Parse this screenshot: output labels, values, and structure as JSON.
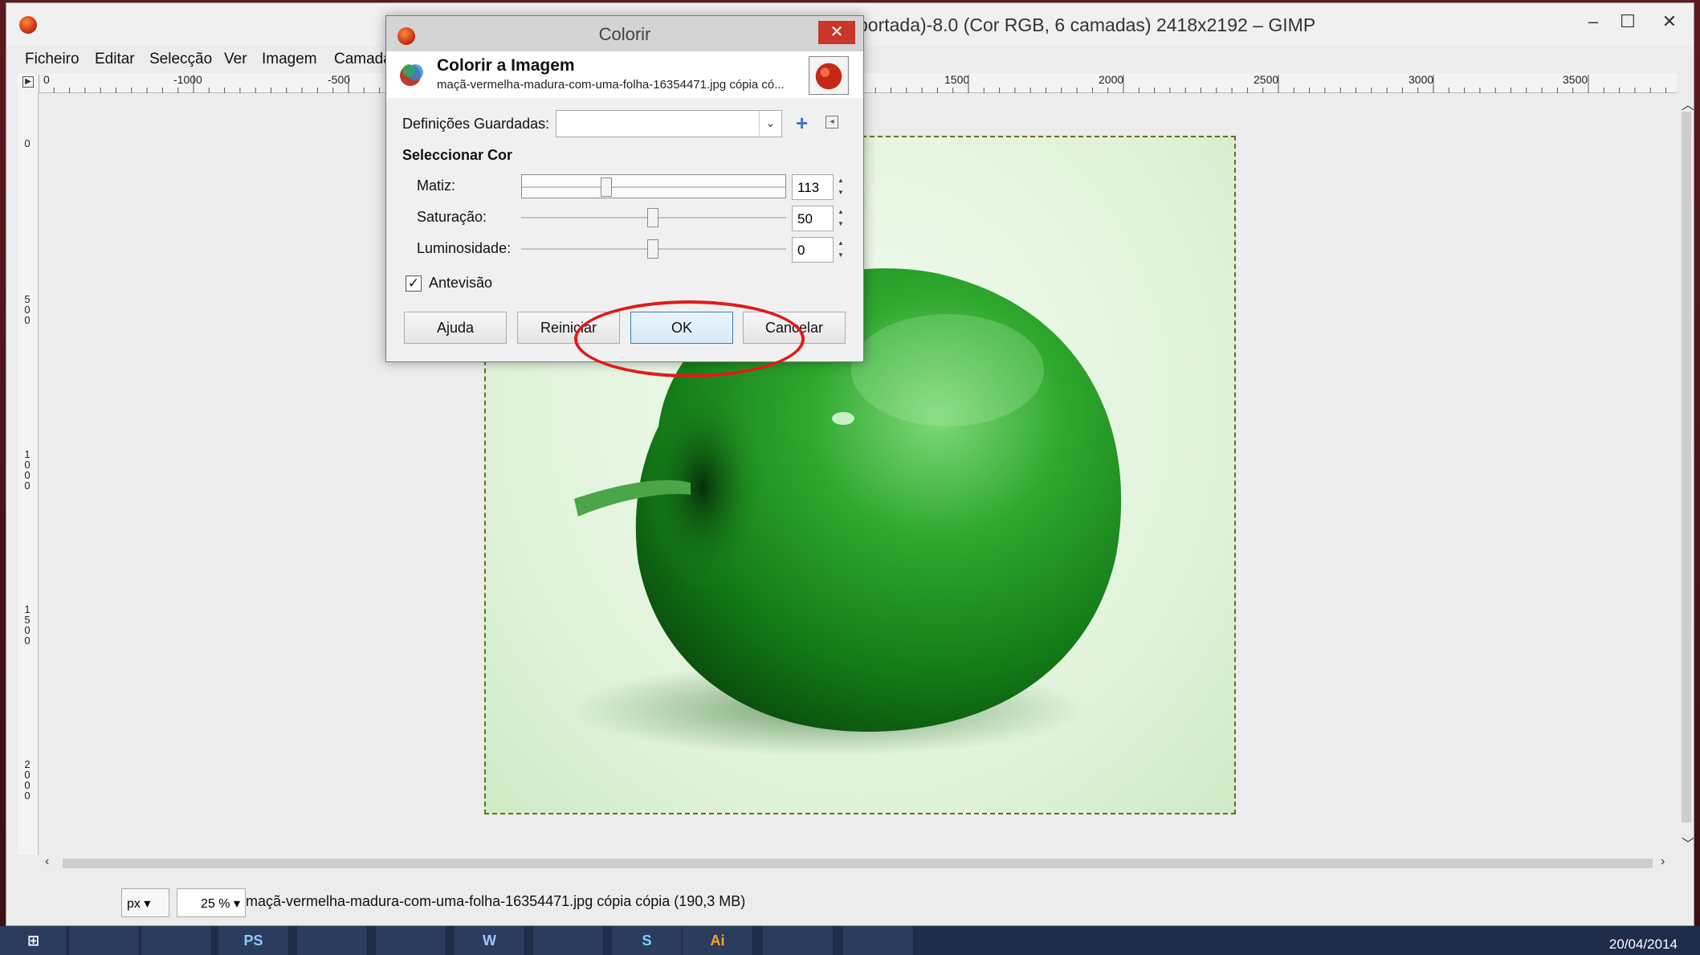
{
  "window": {
    "title": "portada)-8.0 (Cor RGB, 6 camadas) 2418x2192 – GIMP",
    "controls": {
      "minimize": "‒",
      "maximize": "☐",
      "close": "✕"
    }
  },
  "menubar": {
    "items": [
      "Ficheiro",
      "Editar",
      "Selecção",
      "Ver",
      "Imagem",
      "Camada"
    ]
  },
  "ruler_top": {
    "ticks": [
      "0",
      "-1000",
      "-500",
      "1500",
      "2000",
      "2500",
      "3000",
      "3500"
    ]
  },
  "ruler_left": {
    "ticks": [
      "0",
      "500",
      "1000",
      "1500",
      "2000"
    ]
  },
  "statusbar": {
    "unit": "px",
    "zoom": "25 %",
    "text": "maçã-vermelha-madura-com-uma-folha-16354471.jpg cópia cópia (190,3 MB)"
  },
  "taskbar": {
    "apps": [
      "",
      "",
      "PS",
      "",
      "",
      "W",
      "",
      "S",
      "Ai",
      "",
      ""
    ],
    "date": "20/04/2014"
  },
  "dialog": {
    "title": "Colorir",
    "close": "✕",
    "heading": "Colorir a Imagem",
    "subheading": "maçã-vermelha-madura-com-uma-folha-16354471.jpg cópia có...",
    "presets_label": "Definições Guardadas:",
    "presets_value": "",
    "section_heading": "Seleccionar Cor",
    "sliders": [
      {
        "label": "Matiz:",
        "value": "113",
        "fraction": 0.3139
      },
      {
        "label": "Saturação:",
        "value": "50",
        "fraction": 0.5
      },
      {
        "label": "Luminosidade:",
        "value": "0",
        "fraction": 0.5
      }
    ],
    "preview_label": "Antevisão",
    "preview_checked": true,
    "buttons": {
      "help": "Ajuda",
      "reset": "Reiniciar",
      "ok": "OK",
      "cancel": "Cancelar"
    }
  },
  "colors": {
    "highlight": "#e01a1a",
    "apple": "#1f8f1f",
    "close_button": "#c7382b"
  }
}
